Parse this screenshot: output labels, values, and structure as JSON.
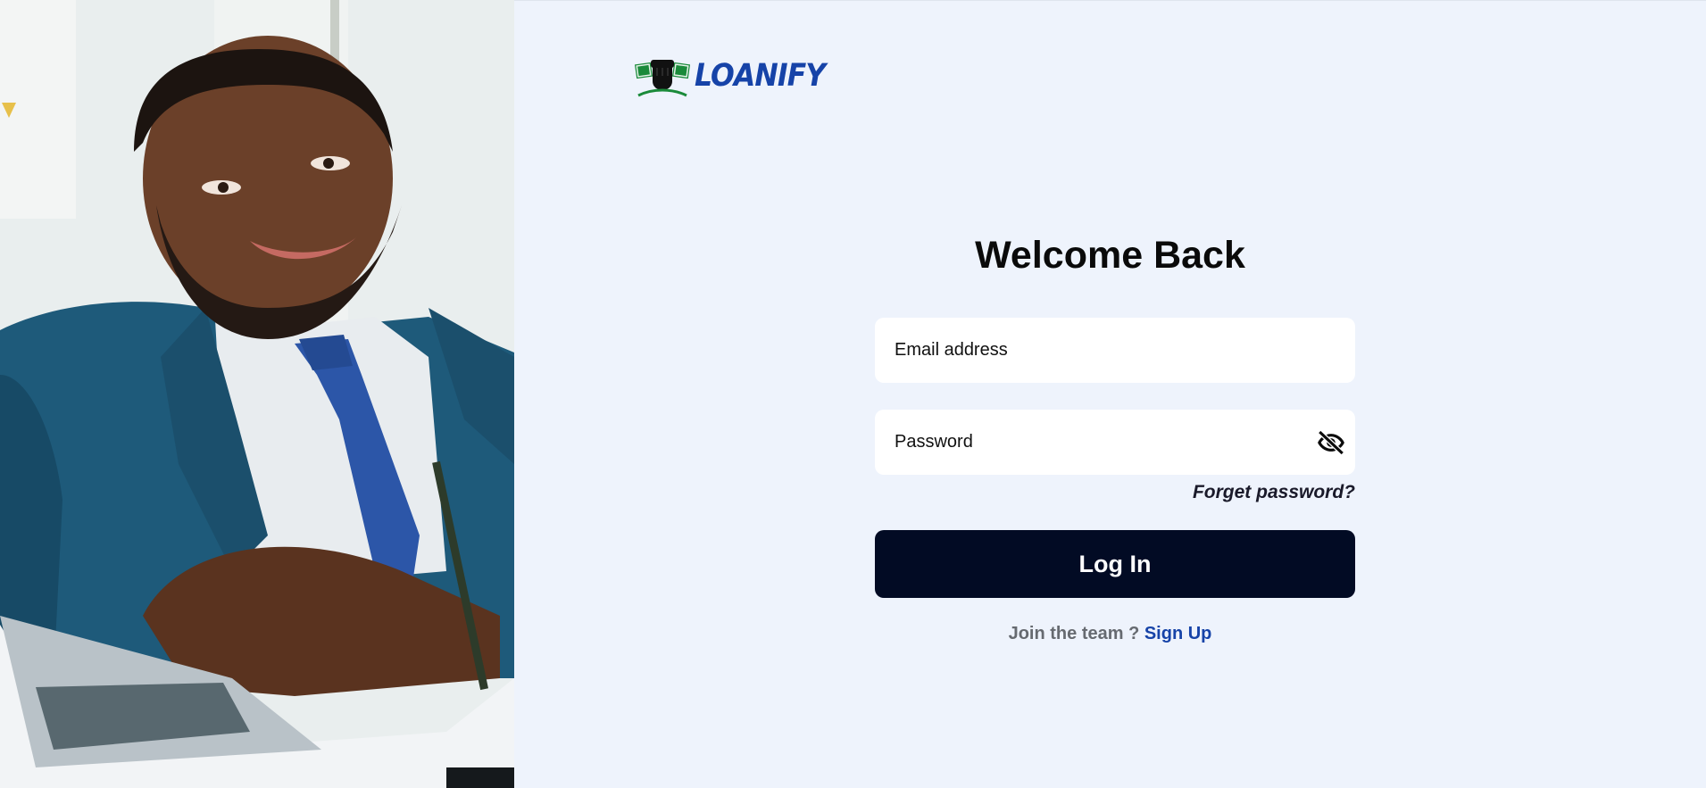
{
  "brand": {
    "name": "LOANIFY",
    "logo_icon": "fist-money-icon",
    "color": "#1643a8",
    "accent": "#1a8a3a"
  },
  "hero": {
    "image": "smiling-businessman-photo"
  },
  "login": {
    "title": "Welcome Back",
    "email_placeholder": "Email address",
    "password_placeholder": "Password",
    "password_toggle_icon": "eye-slash-icon",
    "forgot_label": "Forget password?",
    "submit_label": "Log In",
    "signup_prompt": "Join the team ?",
    "signup_link": "Sign Up"
  },
  "colors": {
    "background": "#eef3fc",
    "button": "#020b24",
    "link": "#1643a8"
  }
}
